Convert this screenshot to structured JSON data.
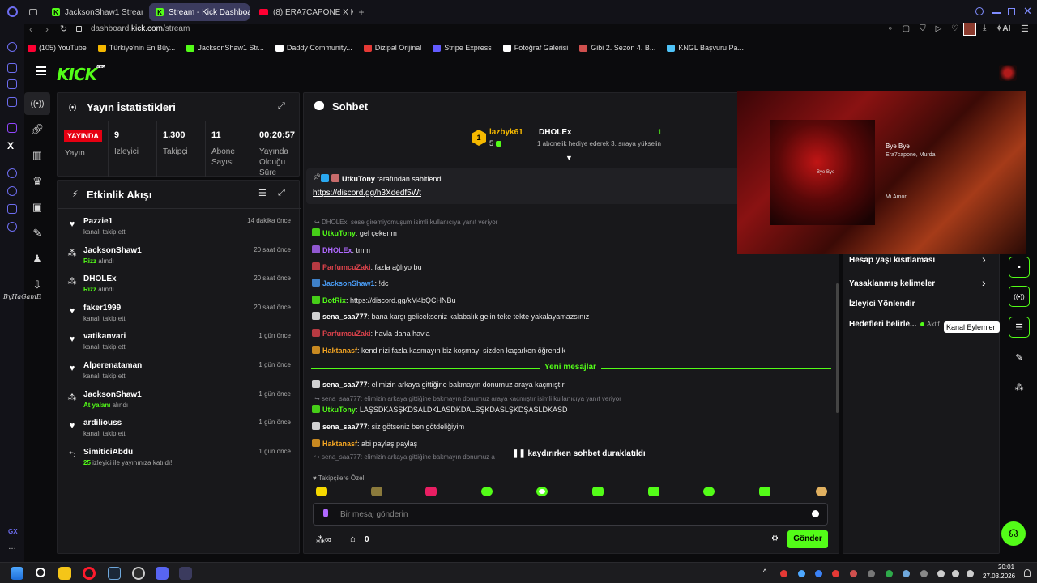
{
  "browser": {
    "tabs": [
      {
        "label": "JacksonShaw1 Stream - W"
      },
      {
        "label": "Stream - Kick Dashboard"
      },
      {
        "label": "(8) ERA7CAPONE X MU"
      }
    ],
    "url_prefix": "dashboard.",
    "url_domain": "kick.com",
    "url_path": "/stream",
    "ai_label": "AI",
    "bookmarks": [
      {
        "label": "(105) YouTube",
        "color": "#ff0033"
      },
      {
        "label": "Türkiye'nin En Büy...",
        "color": "#f5b800"
      },
      {
        "label": "JacksonShaw1 Str...",
        "color": "#53fc18"
      },
      {
        "label": "Daddy Community...",
        "color": "#ffffff"
      },
      {
        "label": "Dizipal Orijinal",
        "color": "#e53935"
      },
      {
        "label": "Stripe Express",
        "color": "#635bff"
      },
      {
        "label": "Fotoğraf Galerisi",
        "color": "#ffffff"
      },
      {
        "label": "Gibi 2. Sezon 4. B...",
        "color": "#d0504e"
      },
      {
        "label": "KNGL Başvuru Pa...",
        "color": "#4fc3f7"
      }
    ],
    "side_watermark": "ByHaGamE",
    "gx_label": "GX"
  },
  "kick": {
    "logo": "KICK",
    "logo_beta": "BETA"
  },
  "stats": {
    "title": "Yayın İstatistikleri",
    "live_badge": "YAYINDA",
    "live_label": "Yayın",
    "items": [
      {
        "value": "9",
        "label": "İzleyici"
      },
      {
        "value": "1.300",
        "label": "Takipçi"
      },
      {
        "value": "11",
        "label": "Abone Sayısı"
      },
      {
        "value": "00:20:57",
        "label": "Yayında Olduğu Süre"
      }
    ]
  },
  "activity": {
    "title": "Etkinlik Akışı",
    "events": [
      {
        "icon": "heart-icon",
        "name": "Pazzie1",
        "desc": "kanalı takip etti",
        "highlight": "",
        "time": "14 dakika önce"
      },
      {
        "icon": "gift-icon",
        "name": "JacksonShaw1",
        "desc": " alındı",
        "highlight": "Rizz",
        "time": "20 saat önce"
      },
      {
        "icon": "gift-icon",
        "name": "DHOLEx",
        "desc": " alındı",
        "highlight": "Rizz",
        "time": "20 saat önce"
      },
      {
        "icon": "heart-icon",
        "name": "faker1999",
        "desc": "kanalı takip etti",
        "highlight": "",
        "time": "20 saat önce"
      },
      {
        "icon": "heart-icon",
        "name": "vatikanvari",
        "desc": "kanalı takip etti",
        "highlight": "",
        "time": "1 gün önce"
      },
      {
        "icon": "heart-icon",
        "name": "Alperenataman",
        "desc": "kanalı takip etti",
        "highlight": "",
        "time": "1 gün önce"
      },
      {
        "icon": "gift-icon",
        "name": "JacksonShaw1",
        "desc": " alındı",
        "highlight": "At yalanı",
        "time": "1 gün önce"
      },
      {
        "icon": "heart-icon",
        "name": "ardiliouss",
        "desc": "kanalı takip etti",
        "highlight": "",
        "time": "1 gün önce"
      },
      {
        "icon": "raid-icon",
        "name": "SimiticiAbdu",
        "desc": " izleyici ile yayınınıza katıldı!",
        "highlight": "25",
        "time": "1 gün önce"
      }
    ]
  },
  "chat": {
    "title": "Sohbet",
    "gifter_top": {
      "name": "lazbyk61",
      "count": "5",
      "rank": "1"
    },
    "gifter_second": {
      "name": "DHOLEx",
      "note": "1 abonelik hediye ederek 3. sıraya yükselin",
      "count": "1"
    },
    "pinned": {
      "by_user": "UtkuTony",
      "by_text": "tarafından sabitlendi",
      "link": "https://discord.gg/h3Xdedf5Wt"
    },
    "messages": [
      {
        "kind": "reply",
        "text": "DHOLEx: sese giremiyomuşum isimli kullanıcıya yanıt veriyor"
      },
      {
        "kind": "msg",
        "user": "UtkuTony",
        "color": "#53fc18",
        "text": ": gel çekerim"
      },
      {
        "kind": "msg",
        "user": "DHOLEx",
        "color": "#b069ff",
        "text": ": tmm"
      },
      {
        "kind": "msg",
        "user": "ParfumcuZaki",
        "color": "#e0434c",
        "text": ": fazla ağlıyo bu"
      },
      {
        "kind": "msg",
        "user": "JacksonShaw1",
        "color": "#4a9cf5",
        "text": ": !dc"
      },
      {
        "kind": "msg",
        "user": "BotRix",
        "color": "#53fc18",
        "text": ": ",
        "link": "https://discord.gg/kM4bQCHNBu"
      },
      {
        "kind": "msg",
        "user": "sena_saa777",
        "color": "#ffffff",
        "text": ": bana karşı gelicekseniz kalabalık gelin teke tekte yakalayamazsınız"
      },
      {
        "kind": "msg",
        "user": "ParfumcuZaki",
        "color": "#e0434c",
        "text": ": havla daha havla"
      },
      {
        "kind": "msg",
        "user": "Haktanasf",
        "color": "#f5a623",
        "text": ": kendinizi fazla kasmayın biz koşmayı sizden kaçarken öğrendik"
      },
      {
        "kind": "divider",
        "text": "Yeni mesajlar"
      },
      {
        "kind": "msg",
        "user": "sena_saa777",
        "color": "#ffffff",
        "text": ": elimizin arkaya gittiğine bakmayın donumuz araya kaçmıştır"
      },
      {
        "kind": "reply",
        "text": "sena_saa777: elimizin arkaya gittiğine bakmayın donumuz araya kaçmıştır isimli kullanıcıya yanıt veriyor"
      },
      {
        "kind": "msg",
        "user": "UtkuTony",
        "color": "#53fc18",
        "text": ": LAŞSDKASŞKDSALDKLASDKDALSŞKDASLŞKDŞASLDKASD"
      },
      {
        "kind": "msg",
        "user": "sena_saa777",
        "color": "#ffffff",
        "text": ": siz götseniz ben götdeliğiyim"
      },
      {
        "kind": "msg",
        "user": "Haktanasf",
        "color": "#f5a623",
        "text": ": abi paylaş paylaş"
      },
      {
        "kind": "reply",
        "text": "sena_saa777: elimizin arkaya gittiğine bakmayın donumuz a"
      }
    ],
    "paused_text": "kaydırırken sohbet duraklatıldı",
    "followers_only": "Takipçilere Özel",
    "input_placeholder": "Bir mesaj gönderin",
    "points_count": "0",
    "send_label": "Gönder"
  },
  "music": {
    "song": "Bye Bye",
    "artist": "Era7capone, Murda",
    "line2": "Mi Amor",
    "cover_text": "Bye Bye"
  },
  "settings": {
    "items": [
      {
        "label": "Hesap yaşı kısıtlaması"
      },
      {
        "label": "Yasaklanmış kelimeler"
      },
      {
        "label": "İzleyici Yönlendir"
      },
      {
        "label": "Hedefleri belirle..."
      }
    ],
    "active_label": "Aktif",
    "tooltip": "Kanal Eylemleri"
  },
  "taskbar": {
    "time": "20:01",
    "date": "27.03.2026"
  },
  "colors": {
    "accent": "#53fc18",
    "panel": "#18181b",
    "live": "#e60012"
  }
}
